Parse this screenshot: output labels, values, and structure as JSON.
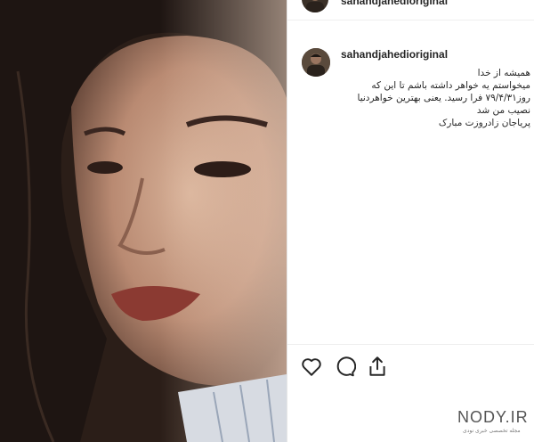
{
  "post": {
    "username": "sahandjahedioriginal",
    "photo": {
      "subject": "portrait-photo"
    }
  },
  "comment": {
    "username": "sahandjahedioriginal",
    "lines": [
      "همیشه از خدا",
      "میخواستم یه خواهر داشته باشم تا این که",
      "روز۷۹/۴/۳۱ فرا رسید. یعنی بهترین خواهردنیا",
      "نصیب من شد",
      "پریاجان زادروزت مبارک"
    ]
  },
  "actions": {
    "like_icon": "heart-icon",
    "comment_icon": "comment-icon",
    "share_icon": "share-icon"
  },
  "watermark": {
    "title": "NODY.IR",
    "subtitle": "مجله تخصصی خبری نودی"
  }
}
